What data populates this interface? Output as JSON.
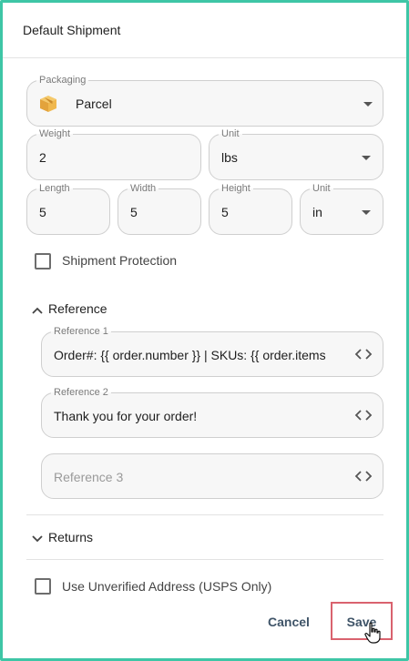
{
  "dialog": {
    "title": "Default Shipment"
  },
  "packaging": {
    "label": "Packaging",
    "value": "Parcel",
    "icon": "parcel-box-icon"
  },
  "weight": {
    "label": "Weight",
    "value": "2"
  },
  "weight_unit": {
    "label": "Unit",
    "value": "lbs"
  },
  "length": {
    "label": "Length",
    "value": "5"
  },
  "width": {
    "label": "Width",
    "value": "5"
  },
  "height": {
    "label": "Height",
    "value": "5"
  },
  "dim_unit": {
    "label": "Unit",
    "value": "in"
  },
  "shipment_protection": {
    "label": "Shipment Protection",
    "checked": false
  },
  "reference_section": {
    "title": "Reference",
    "expanded": true,
    "fields": [
      {
        "label": "Reference 1",
        "value": "Order#: {{ order.number }} | SKUs: {{ order.items"
      },
      {
        "label": "Reference 2",
        "value": "Thank you for your order!"
      },
      {
        "label": "",
        "placeholder": "Reference 3"
      }
    ]
  },
  "returns_section": {
    "title": "Returns",
    "expanded": false
  },
  "unverified_address": {
    "label": "Use Unverified Address (USPS Only)",
    "checked": false
  },
  "actions": {
    "cancel": "Cancel",
    "save": "Save"
  },
  "colors": {
    "frame": "#3ec6a6",
    "button_text": "#3f5468",
    "save_highlight": "#d9626e"
  }
}
